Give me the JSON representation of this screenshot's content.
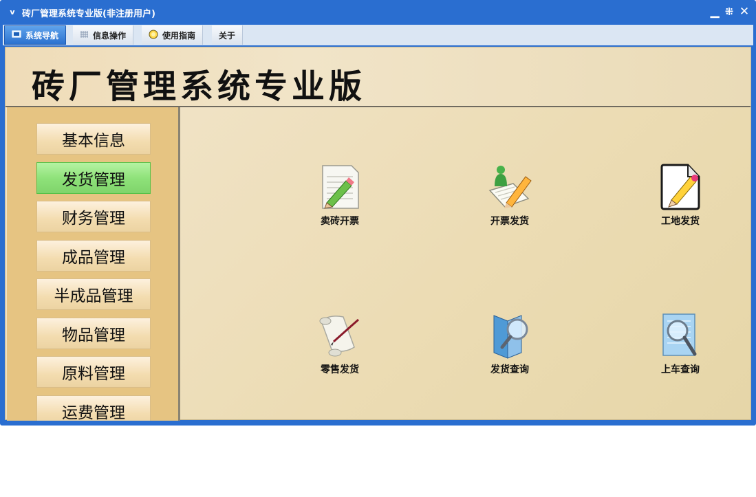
{
  "window": {
    "title": "砖厂管理系统专业版(非注册用户)",
    "app_icon": "ⅴ",
    "controls": {
      "minimize": "▁",
      "restore": "⁜",
      "close": "✕"
    }
  },
  "tabs": [
    {
      "label": "系统导航",
      "icon": "monitor-icon",
      "active": true
    },
    {
      "label": "信息操作",
      "icon": "grid-icon",
      "active": false
    },
    {
      "label": "使用指南",
      "icon": "help-icon",
      "active": false
    },
    {
      "label": "关于",
      "icon": "",
      "active": false
    }
  ],
  "header": {
    "title": "砖厂管理系统专业版"
  },
  "sidebar": {
    "items": [
      {
        "label": "基本信息"
      },
      {
        "label": "发货管理"
      },
      {
        "label": "财务管理"
      },
      {
        "label": "成品管理"
      },
      {
        "label": "半成品管理"
      },
      {
        "label": "物品管理"
      },
      {
        "label": "原料管理"
      },
      {
        "label": "运费管理"
      }
    ],
    "selected": "发货管理"
  },
  "main": {
    "tiles": [
      {
        "label": "卖砖开票",
        "icon": "document-pencil-icon"
      },
      {
        "label": "开票发货",
        "icon": "person-pencil-icon"
      },
      {
        "label": "工地发货",
        "icon": "edit-page-icon"
      },
      {
        "label": "零售发货",
        "icon": "scroll-quill-icon"
      },
      {
        "label": "发货查询",
        "icon": "book-magnifier-icon"
      },
      {
        "label": "上车查询",
        "icon": "page-magnifier-icon"
      }
    ]
  },
  "colors": {
    "window_frame": "#2a6ed0",
    "active_tab": "#3a82dc",
    "sidebar_bg": "#e6c482",
    "selected_item": "#8fe27a",
    "content_bg": "#ecdcb4"
  }
}
